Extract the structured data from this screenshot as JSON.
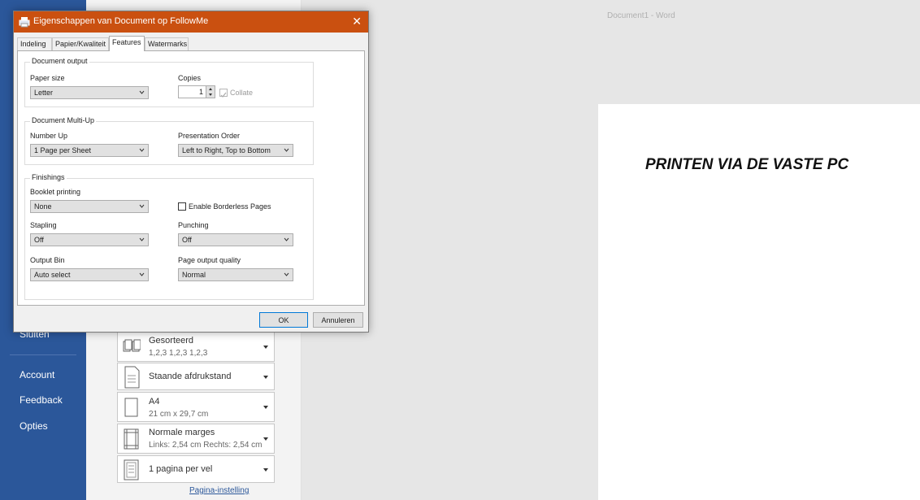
{
  "word": {
    "window_title": "Document1  -  Word"
  },
  "backstage_nav": [
    {
      "label": "Sluiten"
    },
    {
      "label": "Account"
    },
    {
      "label": "Feedback"
    },
    {
      "label": "Opties"
    }
  ],
  "print_settings": [
    {
      "main": "Gesorteerd",
      "sub": "1,2,3   1,2,3   1,2,3",
      "icon": "collate-icon"
    },
    {
      "main": "Staande afdrukstand",
      "sub": "",
      "icon": "portrait-icon"
    },
    {
      "main": "A4",
      "sub": "21 cm x 29,7 cm",
      "icon": "paper-size-icon"
    },
    {
      "main": "Normale marges",
      "sub": "Links: 2,54 cm   Rechts: 2,54 cm",
      "icon": "margins-icon"
    },
    {
      "main": "1 pagina per vel",
      "sub": "",
      "icon": "pages-per-sheet-icon"
    }
  ],
  "page_setup_link": "Pagina-instelling",
  "preview": {
    "text": "PRINTEN VIA DE VASTE PC"
  },
  "dialog": {
    "title": "Eigenschappen van Document op FollowMe",
    "close": "✕",
    "tabs": [
      "Indeling",
      "Papier/Kwaliteit",
      "Features",
      "Watermarks"
    ],
    "active_tab": "Features",
    "document_output": {
      "legend": "Document output",
      "paper_size_label": "Paper size",
      "paper_size_value": "Letter",
      "copies_label": "Copies",
      "copies_value": "1",
      "collate_label": "Collate",
      "collate_checked": true
    },
    "multi_up": {
      "legend": "Document Multi-Up",
      "number_up_label": "Number Up",
      "number_up_value": "1 Page per Sheet",
      "order_label": "Presentation Order",
      "order_value": "Left to Right, Top to Bottom"
    },
    "finishings": {
      "legend": "Finishings",
      "booklet_label": "Booklet printing",
      "booklet_value": "None",
      "borderless_label": "Enable Borderless Pages",
      "stapling_label": "Stapling",
      "stapling_value": "Off",
      "punching_label": "Punching",
      "punching_value": "Off",
      "output_bin_label": "Output Bin",
      "output_bin_value": "Auto select",
      "quality_label": "Page output quality",
      "quality_value": "Normal"
    },
    "ok": "OK",
    "cancel": "Annuleren"
  },
  "colors": {
    "word_blue": "#2b579a",
    "dialog_title": "#ca5010"
  }
}
